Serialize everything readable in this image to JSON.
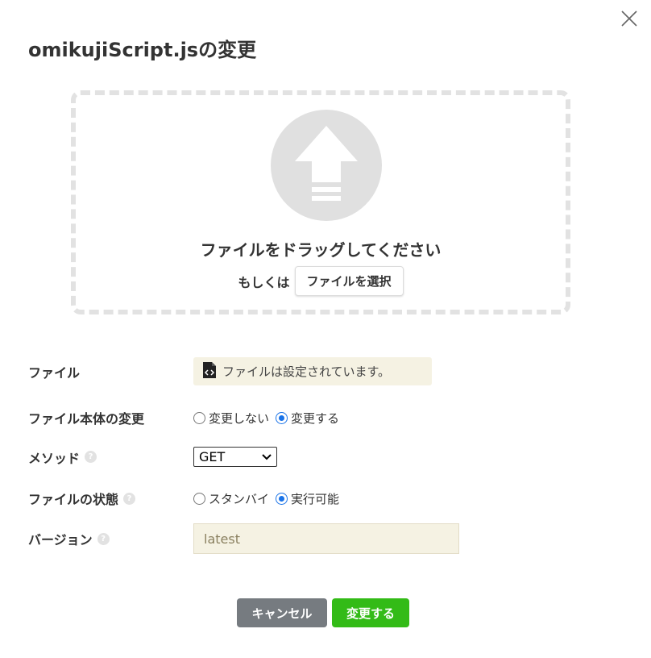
{
  "dialog": {
    "title": "omikujiScript.jsの変更"
  },
  "dropzone": {
    "drag_text": "ファイルをドラッグしてください",
    "or_text": "もしくは",
    "select_button": "ファイルを選択"
  },
  "form": {
    "file_label": "ファイル",
    "file_status": "ファイルは設定されています。",
    "change_body_label": "ファイル本体の変更",
    "change_body_options": [
      "変更しない",
      "変更する"
    ],
    "change_body_selected": "変更する",
    "method_label": "メソッド",
    "method_value": "GET",
    "state_label": "ファイルの状態",
    "state_options": [
      "スタンバイ",
      "実行可能"
    ],
    "state_selected": "実行可能",
    "version_label": "バージョン",
    "version_value": "latest"
  },
  "footer": {
    "cancel_label": "キャンセル",
    "submit_label": "変更する"
  },
  "colors": {
    "accent": "#1a73e8",
    "submit": "#33bb17",
    "cancel": "#767b80",
    "field_bg": "#f5f2e3"
  },
  "icons": {
    "close": "close-icon",
    "upload": "upload-arrow-icon",
    "help": "help-icon",
    "file": "code-file-icon",
    "chevron": "chevron-down-icon"
  }
}
